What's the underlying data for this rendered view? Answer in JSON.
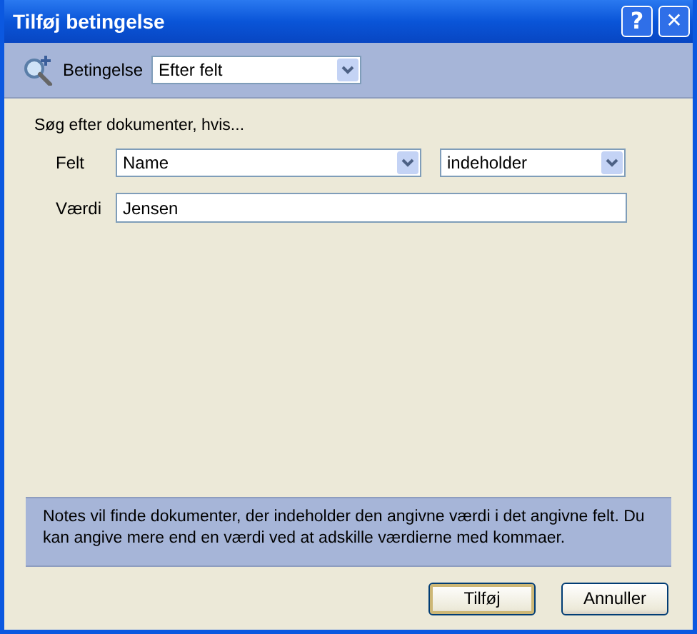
{
  "window": {
    "title": "Tilføj betingelse"
  },
  "title_buttons": [
    {
      "kind": "help",
      "label": "?"
    },
    {
      "kind": "close",
      "label": "✕"
    }
  ],
  "condition": {
    "label": "Betingelse",
    "value": "Efter felt"
  },
  "heading": "Søg efter dokumenter, hvis...",
  "field_row": {
    "label": "Felt",
    "field": "Name",
    "operator": "indeholder"
  },
  "value_row": {
    "label": "Værdi",
    "value": "Jensen"
  },
  "help_text": "Notes vil finde dokumenter, der indeholder den angivne værdi i det angivne felt. Du kan angive mere end en værdi ved at adskille værdierne med kommaer.",
  "buttons": [
    {
      "label": "Tilføj",
      "default": true
    },
    {
      "label": "Annuller",
      "default": false
    }
  ]
}
